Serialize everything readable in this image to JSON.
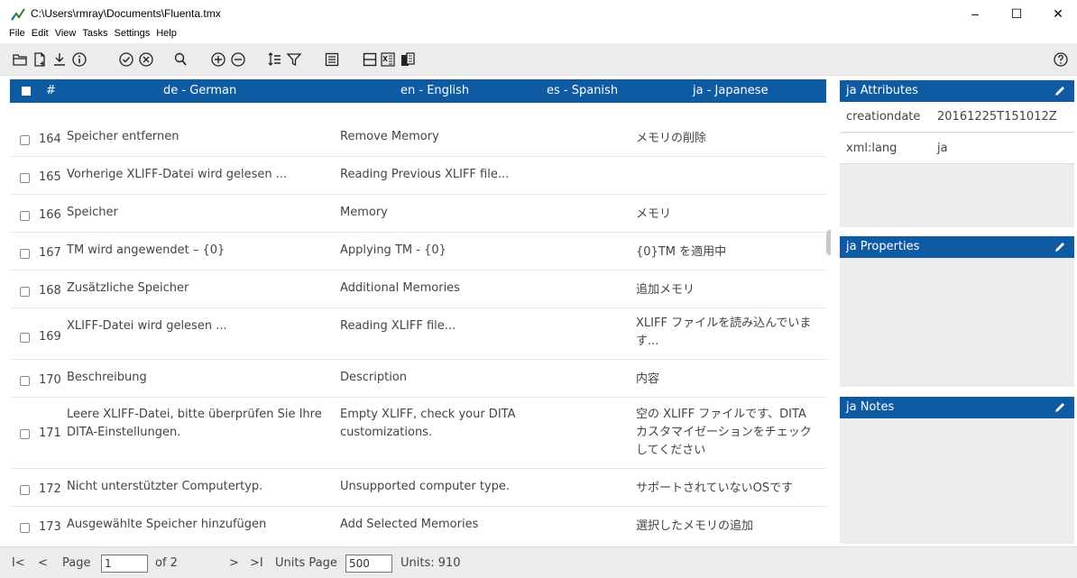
{
  "window": {
    "title": "C:\\Users\\rmray\\Documents\\Fluenta.tmx",
    "minimize": "–",
    "maximize": "☐",
    "close": "✕"
  },
  "menu": [
    "File",
    "Edit",
    "View",
    "Tasks",
    "Settings",
    "Help"
  ],
  "toolbar": {
    "icons": [
      "open-folder-icon",
      "new-file-icon",
      "download-icon",
      "info-icon",
      "check-circle-icon",
      "cancel-circle-icon",
      "search-replace-icon",
      "add-circle-icon",
      "remove-circle-icon",
      "sort-icon",
      "filter-icon",
      "list-icon",
      "split-icon",
      "excel-icon",
      "merge-icon",
      "help-icon"
    ]
  },
  "table": {
    "headers": {
      "num": "#",
      "de": "de - German",
      "en": "en - English",
      "es": "es - Spanish",
      "ja": "ja - Japanese"
    },
    "rows": [
      {
        "num": "164",
        "de": "Speicher entfernen",
        "en": "Remove Memory",
        "ja": "メモリの削除"
      },
      {
        "num": "165",
        "de": "Vorherige XLIFF-Datei wird gelesen ...",
        "en": "Reading Previous XLIFF file...",
        "ja": ""
      },
      {
        "num": "166",
        "de": "Speicher",
        "en": "Memory",
        "ja": "メモリ"
      },
      {
        "num": "167",
        "de": "TM wird angewendet – {0}",
        "en": "Applying TM - {0}",
        "ja": "{0}TM を適用中"
      },
      {
        "num": "168",
        "de": "Zusätzliche Speicher",
        "en": "Additional Memories",
        "ja": "追加メモリ"
      },
      {
        "num": "169",
        "de": "XLIFF-Datei wird gelesen ...",
        "en": "Reading XLIFF file...",
        "ja": "XLIFF ファイルを読み込んでいます..."
      },
      {
        "num": "170",
        "de": "Beschreibung",
        "en": "Description",
        "ja": "内容"
      },
      {
        "num": "171",
        "de": "Leere XLIFF-Datei, bitte überprüfen Sie Ihre DITA-Einstellungen.",
        "en": "Empty XLIFF, check your DITA customizations.",
        "ja": "空の XLIFF ファイルです、DITA カスタマイゼーションをチェックしてください"
      },
      {
        "num": "172",
        "de": "Nicht unterstützter Computertyp.",
        "en": "Unsupported computer type.",
        "ja": "サポートされていないOSです"
      },
      {
        "num": "173",
        "de": "Ausgewählte Speicher hinzufügen",
        "en": "Add Selected Memories",
        "ja": "選択したメモリの追加"
      }
    ]
  },
  "attributes": {
    "title": "ja  Attributes",
    "items": [
      {
        "key": "creationdate",
        "value": "20161225T151012Z"
      },
      {
        "key": "xml:lang",
        "value": "ja"
      }
    ]
  },
  "properties": {
    "title": "ja  Properties"
  },
  "notes": {
    "title": "ja  Notes"
  },
  "pager": {
    "first": "I<",
    "prev": "<",
    "page_label": "Page",
    "page_value": "1",
    "of_label": "of 2",
    "next": ">",
    "last": ">I",
    "units_page_label": "Units Page",
    "units_page_value": "500",
    "units_label": "Units: 910"
  },
  "colors": {
    "accent": "#0f5ba3",
    "panel_bg": "#ececec"
  }
}
